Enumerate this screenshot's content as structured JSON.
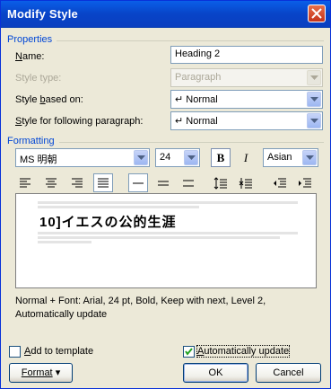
{
  "window": {
    "title": "Modify Style"
  },
  "properties": {
    "section_label": "Properties",
    "name_label": "Name:",
    "name_value": "Heading 2",
    "style_type_label": "Style type:",
    "style_type_value": "Paragraph",
    "style_based_on_label": "Style based on:",
    "style_based_on_value": "Normal",
    "style_following_label": "Style for following paragraph:",
    "style_following_value": "Normal"
  },
  "formatting": {
    "section_label": "Formatting",
    "font_name": "MS 明朝",
    "font_size": "24",
    "bold_label": "B",
    "italic_label": "I",
    "script_value": "Asian"
  },
  "preview": {
    "sample_text": "10]イエスの公的生涯"
  },
  "description": {
    "text": "Normal + Font: Arial, 24 pt, Bold, Keep with next, Level 2, Automatically update"
  },
  "options": {
    "add_to_template_label": "Add to template",
    "add_to_template_checked": false,
    "auto_update_label": "Automatically update",
    "auto_update_checked": true
  },
  "buttons": {
    "format_label": "Format",
    "ok_label": "OK",
    "cancel_label": "Cancel"
  }
}
